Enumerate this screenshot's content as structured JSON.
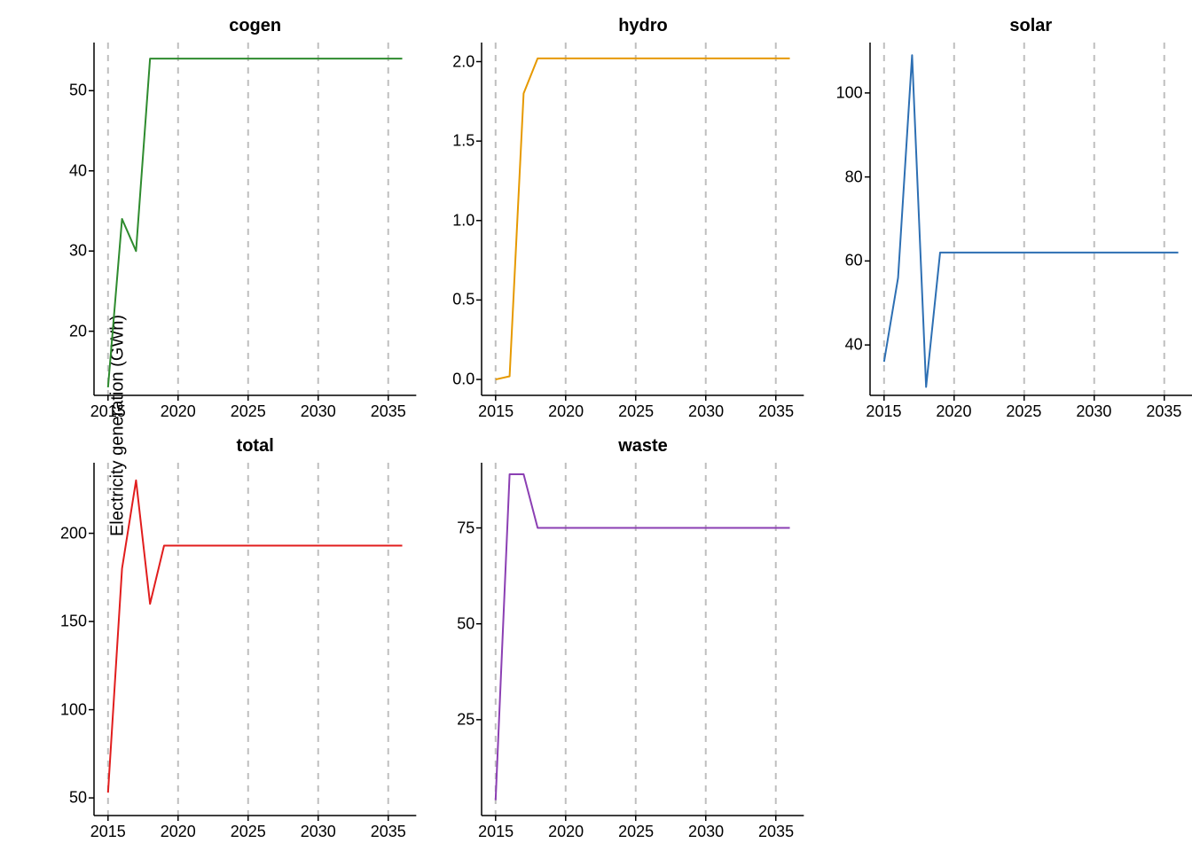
{
  "ylabel": "Electricity generation (GWh)",
  "x_ticks": [
    2015,
    2020,
    2025,
    2030,
    2035
  ],
  "x_range": [
    2014,
    2037
  ],
  "panels": [
    {
      "key": "cogen",
      "title": "cogen",
      "row": 0,
      "col": 0,
      "color": "#2e8b2e",
      "y_ticks": [
        20,
        30,
        40,
        50
      ],
      "y_range": [
        12,
        56
      ]
    },
    {
      "key": "hydro",
      "title": "hydro",
      "row": 0,
      "col": 1,
      "color": "#e69900",
      "y_ticks": [
        0.0,
        0.5,
        1.0,
        1.5,
        2.0
      ],
      "y_range": [
        -0.1,
        2.12
      ]
    },
    {
      "key": "solar",
      "title": "solar",
      "row": 0,
      "col": 2,
      "color": "#2d6fb3",
      "y_ticks": [
        40,
        60,
        80,
        100
      ],
      "y_range": [
        28,
        112
      ]
    },
    {
      "key": "total",
      "title": "total",
      "row": 1,
      "col": 0,
      "color": "#e11d1d",
      "y_ticks": [
        50,
        100,
        150,
        200
      ],
      "y_range": [
        40,
        240
      ]
    },
    {
      "key": "waste",
      "title": "waste",
      "row": 1,
      "col": 1,
      "color": "#8b3fb3",
      "y_ticks": [
        25,
        50,
        75
      ],
      "y_range": [
        0,
        92
      ]
    }
  ],
  "chart_data": [
    {
      "type": "line",
      "name": "cogen",
      "color": "#2e8b2e",
      "xlabel": "",
      "ylabel": "",
      "x": [
        2015,
        2016,
        2017,
        2018,
        2019,
        2020,
        2021,
        2022,
        2023,
        2024,
        2025,
        2026,
        2027,
        2028,
        2029,
        2030,
        2031,
        2032,
        2033,
        2034,
        2035,
        2036
      ],
      "y": [
        13,
        34,
        30,
        54,
        54,
        54,
        54,
        54,
        54,
        54,
        54,
        54,
        54,
        54,
        54,
        54,
        54,
        54,
        54,
        54,
        54,
        54
      ],
      "ylim": [
        12,
        56
      ]
    },
    {
      "type": "line",
      "name": "hydro",
      "color": "#e69900",
      "xlabel": "",
      "ylabel": "",
      "x": [
        2015,
        2016,
        2017,
        2018,
        2019,
        2020,
        2021,
        2022,
        2023,
        2024,
        2025,
        2026,
        2027,
        2028,
        2029,
        2030,
        2031,
        2032,
        2033,
        2034,
        2035,
        2036
      ],
      "y": [
        0.0,
        0.02,
        1.8,
        2.02,
        2.02,
        2.02,
        2.02,
        2.02,
        2.02,
        2.02,
        2.02,
        2.02,
        2.02,
        2.02,
        2.02,
        2.02,
        2.02,
        2.02,
        2.02,
        2.02,
        2.02,
        2.02
      ],
      "ylim": [
        -0.1,
        2.12
      ]
    },
    {
      "type": "line",
      "name": "solar",
      "color": "#2d6fb3",
      "xlabel": "",
      "ylabel": "",
      "x": [
        2015,
        2016,
        2017,
        2018,
        2019,
        2020,
        2021,
        2022,
        2023,
        2024,
        2025,
        2026,
        2027,
        2028,
        2029,
        2030,
        2031,
        2032,
        2033,
        2034,
        2035,
        2036
      ],
      "y": [
        36,
        56,
        109,
        30,
        62,
        62,
        62,
        62,
        62,
        62,
        62,
        62,
        62,
        62,
        62,
        62,
        62,
        62,
        62,
        62,
        62,
        62
      ],
      "ylim": [
        28,
        112
      ]
    },
    {
      "type": "line",
      "name": "total",
      "color": "#e11d1d",
      "xlabel": "",
      "ylabel": "",
      "x": [
        2015,
        2016,
        2017,
        2018,
        2019,
        2020,
        2021,
        2022,
        2023,
        2024,
        2025,
        2026,
        2027,
        2028,
        2029,
        2030,
        2031,
        2032,
        2033,
        2034,
        2035,
        2036
      ],
      "y": [
        53,
        180,
        230,
        160,
        193,
        193,
        193,
        193,
        193,
        193,
        193,
        193,
        193,
        193,
        193,
        193,
        193,
        193,
        193,
        193,
        193,
        193
      ],
      "ylim": [
        40,
        240
      ]
    },
    {
      "type": "line",
      "name": "waste",
      "color": "#8b3fb3",
      "xlabel": "",
      "ylabel": "",
      "x": [
        2015,
        2016,
        2017,
        2018,
        2019,
        2020,
        2021,
        2022,
        2023,
        2024,
        2025,
        2026,
        2027,
        2028,
        2029,
        2030,
        2031,
        2032,
        2033,
        2034,
        2035,
        2036
      ],
      "y": [
        4,
        89,
        89,
        75,
        75,
        75,
        75,
        75,
        75,
        75,
        75,
        75,
        75,
        75,
        75,
        75,
        75,
        75,
        75,
        75,
        75,
        75
      ],
      "ylim": [
        0,
        92
      ]
    }
  ]
}
